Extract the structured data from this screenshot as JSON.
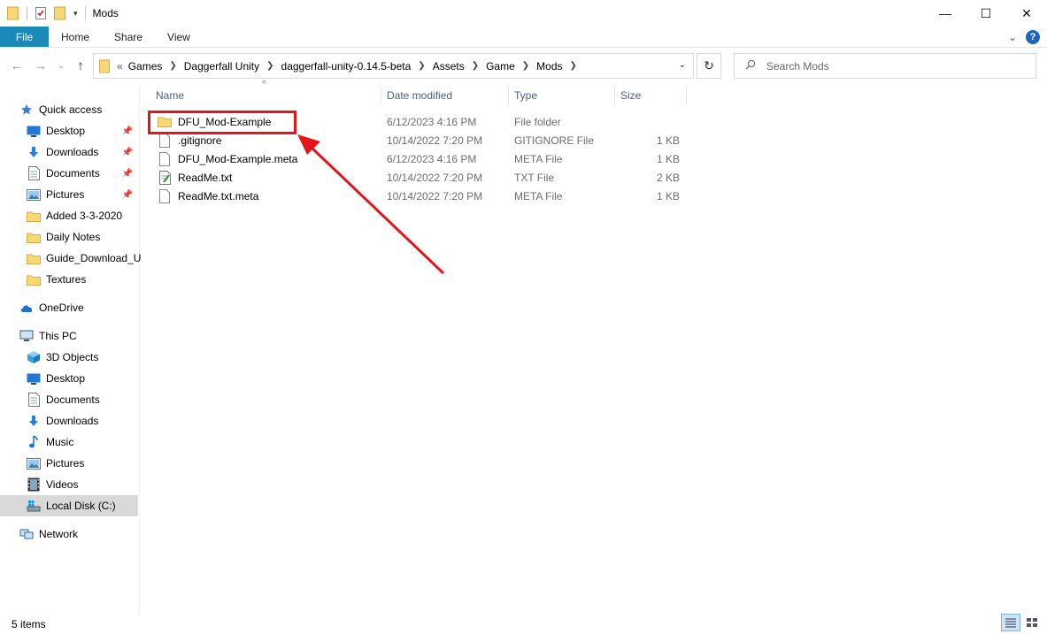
{
  "window": {
    "title": "Mods",
    "controls": {
      "minimize": "—",
      "maximize": "☐",
      "close": "✕"
    }
  },
  "ribbon": {
    "tabs": [
      "File",
      "Home",
      "Share",
      "View"
    ],
    "help": "?",
    "expand": "⌄"
  },
  "nav": {
    "back": "←",
    "forward": "→",
    "recent": "⌄",
    "up": "↑",
    "overflow": "«",
    "breadcrumbs": [
      "Games",
      "Daggerfall Unity",
      "daggerfall-unity-0.14.5-beta",
      "Assets",
      "Game",
      "Mods"
    ],
    "refresh": "↻",
    "search_placeholder": "Search Mods"
  },
  "sidebar": {
    "quick_access": "Quick access",
    "quick_items": [
      {
        "label": "Desktop",
        "icon": "desktop-icon",
        "pinned": true
      },
      {
        "label": "Downloads",
        "icon": "downloads-icon",
        "pinned": true
      },
      {
        "label": "Documents",
        "icon": "documents-icon",
        "pinned": true
      },
      {
        "label": "Pictures",
        "icon": "pictures-icon",
        "pinned": true
      },
      {
        "label": "Added 3-3-2020",
        "icon": "folder-icon",
        "pinned": false
      },
      {
        "label": "Daily Notes",
        "icon": "folder-icon",
        "pinned": false
      },
      {
        "label": "Guide_Download_U",
        "icon": "folder-icon",
        "pinned": false
      },
      {
        "label": "Textures",
        "icon": "folder-icon",
        "pinned": false
      }
    ],
    "onedrive": "OneDrive",
    "this_pc": "This PC",
    "pc_items": [
      {
        "label": "3D Objects",
        "icon": "3d-objects-icon"
      },
      {
        "label": "Desktop",
        "icon": "desktop-icon"
      },
      {
        "label": "Documents",
        "icon": "documents-icon"
      },
      {
        "label": "Downloads",
        "icon": "downloads-icon"
      },
      {
        "label": "Music",
        "icon": "music-icon"
      },
      {
        "label": "Pictures",
        "icon": "pictures-icon"
      },
      {
        "label": "Videos",
        "icon": "videos-icon"
      },
      {
        "label": "Local Disk (C:)",
        "icon": "local-disk-icon",
        "selected": true
      }
    ],
    "network": "Network"
  },
  "columns": {
    "name": "Name",
    "date": "Date modified",
    "type": "Type",
    "size": "Size"
  },
  "files": [
    {
      "name": "DFU_Mod-Example",
      "date": "6/12/2023 4:16 PM",
      "type": "File folder",
      "size": "",
      "icon": "folder-icon"
    },
    {
      "name": ".gitignore",
      "date": "10/14/2022 7:20 PM",
      "type": "GITIGNORE File",
      "size": "1 KB",
      "icon": "file-icon"
    },
    {
      "name": "DFU_Mod-Example.meta",
      "date": "6/12/2023 4:16 PM",
      "type": "META File",
      "size": "1 KB",
      "icon": "file-icon"
    },
    {
      "name": "ReadMe.txt",
      "date": "10/14/2022 7:20 PM",
      "type": "TXT File",
      "size": "2 KB",
      "icon": "text-file-icon"
    },
    {
      "name": "ReadMe.txt.meta",
      "date": "10/14/2022 7:20 PM",
      "type": "META File",
      "size": "1 KB",
      "icon": "file-icon"
    }
  ],
  "status": {
    "item_count": "5 items"
  },
  "colors": {
    "accent": "#1a8bb8",
    "annotation": "#e5161b",
    "folder": "#f8d775"
  }
}
